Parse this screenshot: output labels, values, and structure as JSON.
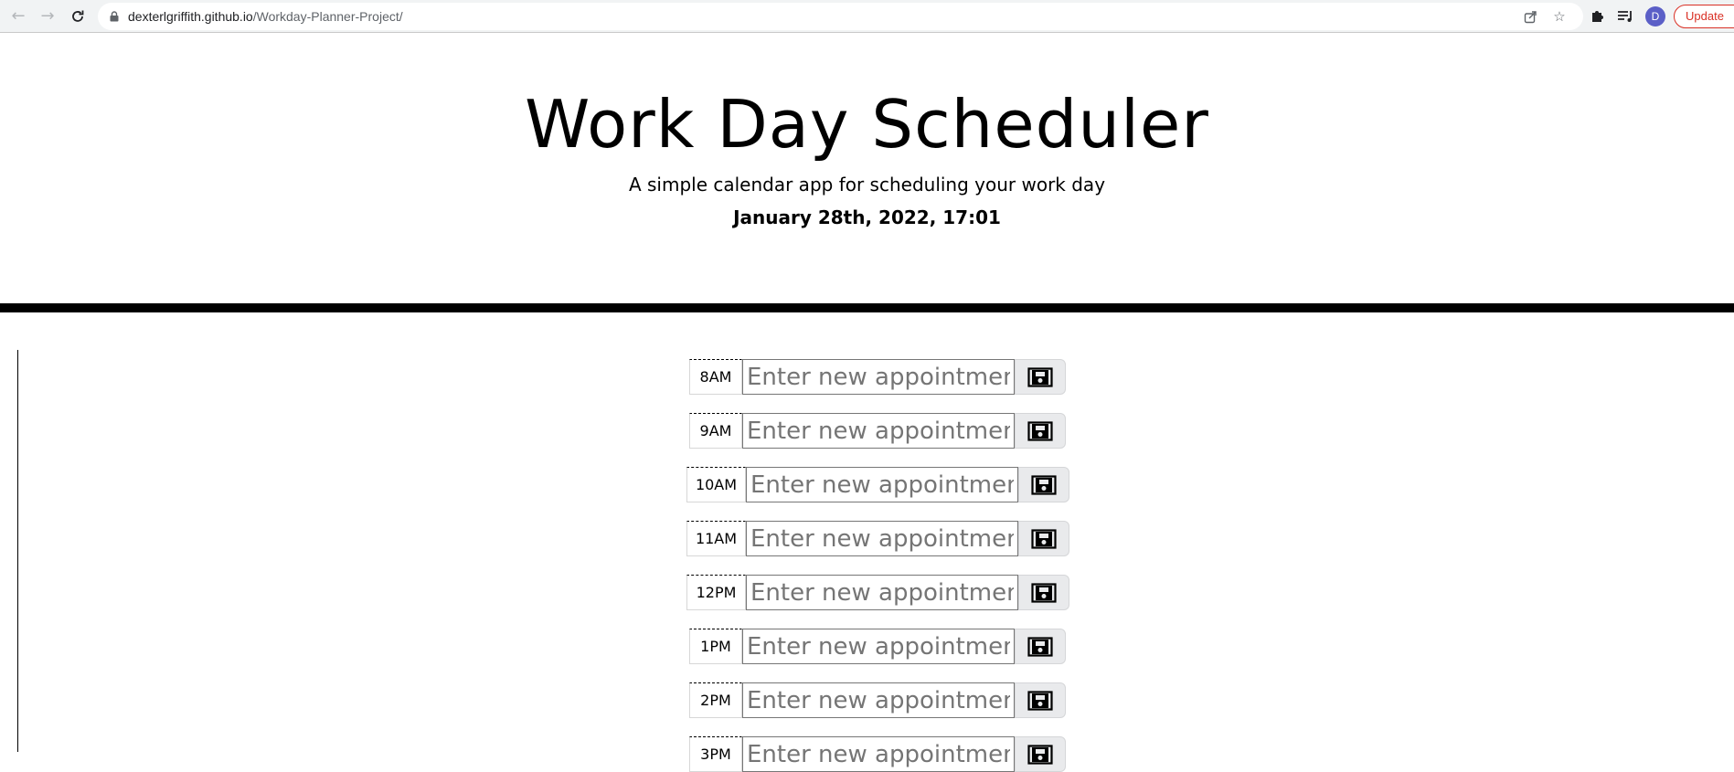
{
  "browser": {
    "url_domain": "dexterlgriffith.github.io",
    "url_path": "/Workday-Planner-Project/",
    "profile_initial": "D",
    "update_label": "Update"
  },
  "header": {
    "title": "Work Day Scheduler",
    "subtitle": "A simple calendar app for scheduling your work day",
    "current_day": "January 28th, 2022, 17:01"
  },
  "time_blocks": [
    {
      "hour": "8AM",
      "placeholder": "Enter new appointment here",
      "value": ""
    },
    {
      "hour": "9AM",
      "placeholder": "Enter new appointment here",
      "value": ""
    },
    {
      "hour": "10AM",
      "placeholder": "Enter new appointment here",
      "value": ""
    },
    {
      "hour": "11AM",
      "placeholder": "Enter new appointment here",
      "value": ""
    },
    {
      "hour": "12PM",
      "placeholder": "Enter new appointment here",
      "value": ""
    },
    {
      "hour": "1PM",
      "placeholder": "Enter new appointment here",
      "value": ""
    },
    {
      "hour": "2PM",
      "placeholder": "Enter new appointment here",
      "value": ""
    },
    {
      "hour": "3PM",
      "placeholder": "Enter new appointment here",
      "value": ""
    }
  ],
  "icons": {
    "save": "floppy-disk-icon"
  }
}
